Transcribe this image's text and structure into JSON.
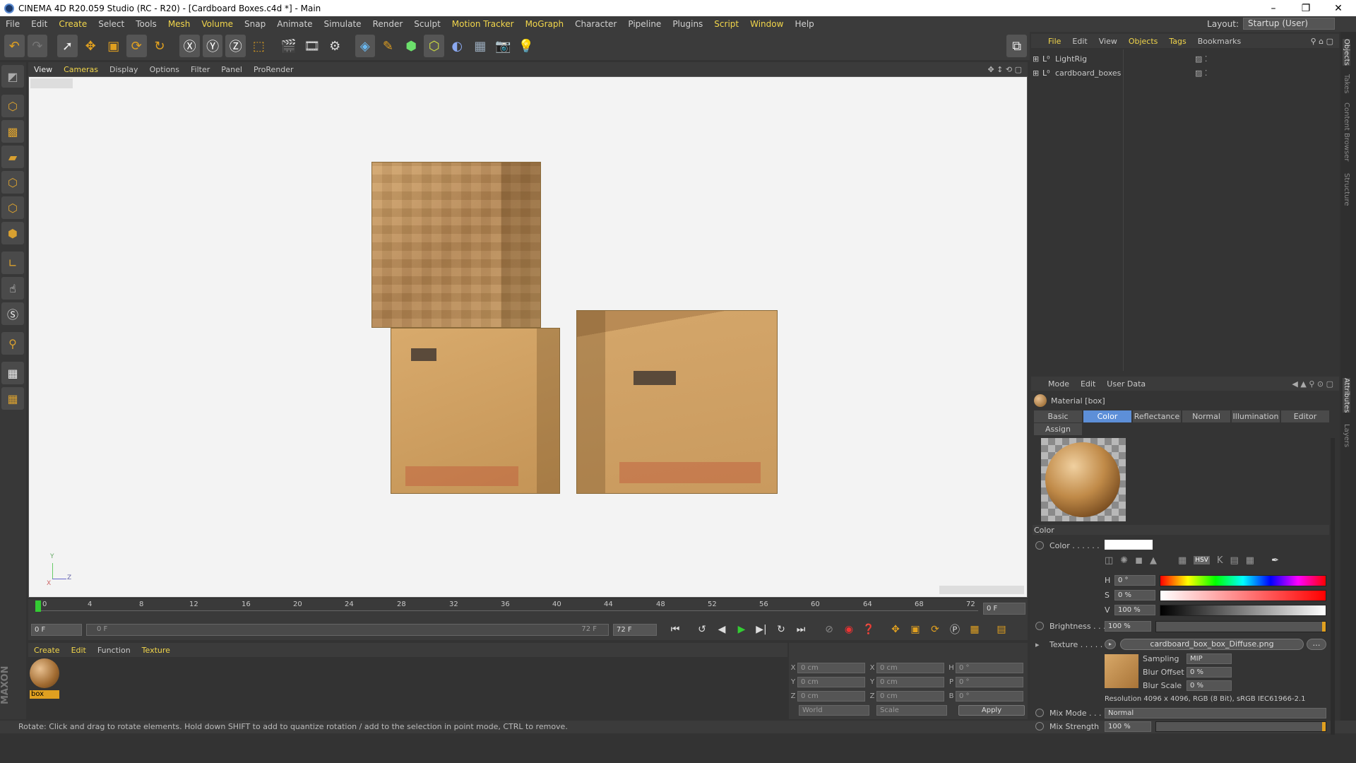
{
  "window": {
    "title": "CINEMA 4D R20.059 Studio (RC - R20) - [Cardboard Boxes.c4d *] - Main",
    "minimize": "–",
    "restore": "❐",
    "close": "✕"
  },
  "menubar": {
    "items": [
      "File",
      "Edit",
      "Create",
      "Select",
      "Tools",
      "Mesh",
      "Volume",
      "Snap",
      "Animate",
      "Simulate",
      "Render",
      "Sculpt",
      "Motion Tracker",
      "MoGraph",
      "Character",
      "Pipeline",
      "Plugins",
      "Script",
      "Window",
      "Help"
    ],
    "layout_label": "Layout:",
    "layout_value": "Startup (User)"
  },
  "viewport": {
    "menu": [
      "View",
      "Cameras",
      "Display",
      "Options",
      "Filter",
      "Panel",
      "ProRender"
    ],
    "axis_y": "Y",
    "axis_z": "Z",
    "axis_x": "X"
  },
  "timeline": {
    "ticks": [
      "0",
      "4",
      "8",
      "12",
      "16",
      "20",
      "24",
      "28",
      "32",
      "36",
      "40",
      "44",
      "48",
      "52",
      "56",
      "60",
      "64",
      "68",
      "72"
    ],
    "current_frame": "0 F",
    "start_field": "0 F",
    "range_start": "0 F",
    "range_end": "72 F",
    "end_field": "72 F"
  },
  "material_manager": {
    "menu": [
      "Create",
      "Edit",
      "Function",
      "Texture"
    ],
    "material_name": "box"
  },
  "coordinates": {
    "rows": [
      {
        "l1": "X",
        "v1": "0 cm",
        "l2": "X",
        "v2": "0 cm",
        "l3": "H",
        "v3": "0 °"
      },
      {
        "l1": "Y",
        "v1": "0 cm",
        "l2": "Y",
        "v2": "0 cm",
        "l3": "P",
        "v3": "0 °"
      },
      {
        "l1": "Z",
        "v1": "0 cm",
        "l2": "Z",
        "v2": "0 cm",
        "l3": "B",
        "v3": "0 °"
      }
    ],
    "world": "World",
    "scale": "Scale",
    "apply": "Apply"
  },
  "status": "Rotate: Click and drag to rotate elements. Hold down SHIFT to add to quantize rotation / add to the selection in point mode, CTRL to remove.",
  "object_manager": {
    "menu": [
      "File",
      "Edit",
      "View",
      "Objects",
      "Tags",
      "Bookmarks"
    ],
    "objects": [
      "LightRig",
      "cardboard_boxes"
    ]
  },
  "side_tabs": [
    "Objects",
    "Takes",
    "Content Browser",
    "Structure",
    "Attributes",
    "Layers"
  ],
  "attributes": {
    "menu": [
      "Mode",
      "Edit",
      "User Data"
    ],
    "title": "Material [box]",
    "tabs": [
      "Basic",
      "Color",
      "Reflectance",
      "Normal",
      "Illumination",
      "Editor"
    ],
    "tab_assign": "Assign",
    "section_color": "Color",
    "color_label": "Color . . . . . .",
    "h_label": "H",
    "h_value": "0 °",
    "s_label": "S",
    "s_value": "0 %",
    "v_label": "V",
    "v_value": "100 %",
    "brightness_label": "Brightness . . .",
    "brightness_value": "100 %",
    "texture_label": "Texture . . . . .",
    "texture_file": "cardboard_box_box_Diffuse.png",
    "sampling_label": "Sampling",
    "sampling_value": "MIP",
    "blur_offset_label": "Blur Offset",
    "blur_offset_value": "0 %",
    "blur_scale_label": "Blur Scale",
    "blur_scale_value": "0 %",
    "resolution": "Resolution 4096 x 4096, RGB (8 Bit), sRGB IEC61966-2.1",
    "mix_mode_label": "Mix Mode . . . .",
    "mix_mode_value": "Normal",
    "mix_strength_label": "Mix Strength",
    "mix_strength_value": "100 %",
    "hsv_mode": "HSV"
  },
  "colors": {
    "accent": "#5d8fd8",
    "highlight_text": "#f2d64b",
    "cardboard": "#c9995c"
  }
}
